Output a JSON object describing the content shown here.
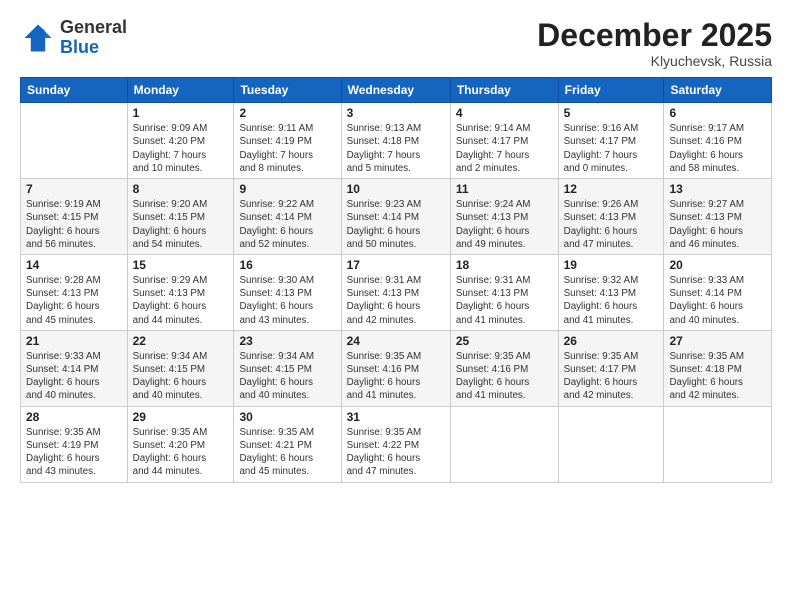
{
  "header": {
    "logo_general": "General",
    "logo_blue": "Blue",
    "month_title": "December 2025",
    "subtitle": "Klyuchevsk, Russia"
  },
  "weekdays": [
    "Sunday",
    "Monday",
    "Tuesday",
    "Wednesday",
    "Thursday",
    "Friday",
    "Saturday"
  ],
  "weeks": [
    [
      {
        "day": "",
        "info": ""
      },
      {
        "day": "1",
        "info": "Sunrise: 9:09 AM\nSunset: 4:20 PM\nDaylight: 7 hours\nand 10 minutes."
      },
      {
        "day": "2",
        "info": "Sunrise: 9:11 AM\nSunset: 4:19 PM\nDaylight: 7 hours\nand 8 minutes."
      },
      {
        "day": "3",
        "info": "Sunrise: 9:13 AM\nSunset: 4:18 PM\nDaylight: 7 hours\nand 5 minutes."
      },
      {
        "day": "4",
        "info": "Sunrise: 9:14 AM\nSunset: 4:17 PM\nDaylight: 7 hours\nand 2 minutes."
      },
      {
        "day": "5",
        "info": "Sunrise: 9:16 AM\nSunset: 4:17 PM\nDaylight: 7 hours\nand 0 minutes."
      },
      {
        "day": "6",
        "info": "Sunrise: 9:17 AM\nSunset: 4:16 PM\nDaylight: 6 hours\nand 58 minutes."
      }
    ],
    [
      {
        "day": "7",
        "info": "Sunrise: 9:19 AM\nSunset: 4:15 PM\nDaylight: 6 hours\nand 56 minutes."
      },
      {
        "day": "8",
        "info": "Sunrise: 9:20 AM\nSunset: 4:15 PM\nDaylight: 6 hours\nand 54 minutes."
      },
      {
        "day": "9",
        "info": "Sunrise: 9:22 AM\nSunset: 4:14 PM\nDaylight: 6 hours\nand 52 minutes."
      },
      {
        "day": "10",
        "info": "Sunrise: 9:23 AM\nSunset: 4:14 PM\nDaylight: 6 hours\nand 50 minutes."
      },
      {
        "day": "11",
        "info": "Sunrise: 9:24 AM\nSunset: 4:13 PM\nDaylight: 6 hours\nand 49 minutes."
      },
      {
        "day": "12",
        "info": "Sunrise: 9:26 AM\nSunset: 4:13 PM\nDaylight: 6 hours\nand 47 minutes."
      },
      {
        "day": "13",
        "info": "Sunrise: 9:27 AM\nSunset: 4:13 PM\nDaylight: 6 hours\nand 46 minutes."
      }
    ],
    [
      {
        "day": "14",
        "info": "Sunrise: 9:28 AM\nSunset: 4:13 PM\nDaylight: 6 hours\nand 45 minutes."
      },
      {
        "day": "15",
        "info": "Sunrise: 9:29 AM\nSunset: 4:13 PM\nDaylight: 6 hours\nand 44 minutes."
      },
      {
        "day": "16",
        "info": "Sunrise: 9:30 AM\nSunset: 4:13 PM\nDaylight: 6 hours\nand 43 minutes."
      },
      {
        "day": "17",
        "info": "Sunrise: 9:31 AM\nSunset: 4:13 PM\nDaylight: 6 hours\nand 42 minutes."
      },
      {
        "day": "18",
        "info": "Sunrise: 9:31 AM\nSunset: 4:13 PM\nDaylight: 6 hours\nand 41 minutes."
      },
      {
        "day": "19",
        "info": "Sunrise: 9:32 AM\nSunset: 4:13 PM\nDaylight: 6 hours\nand 41 minutes."
      },
      {
        "day": "20",
        "info": "Sunrise: 9:33 AM\nSunset: 4:14 PM\nDaylight: 6 hours\nand 40 minutes."
      }
    ],
    [
      {
        "day": "21",
        "info": "Sunrise: 9:33 AM\nSunset: 4:14 PM\nDaylight: 6 hours\nand 40 minutes."
      },
      {
        "day": "22",
        "info": "Sunrise: 9:34 AM\nSunset: 4:15 PM\nDaylight: 6 hours\nand 40 minutes."
      },
      {
        "day": "23",
        "info": "Sunrise: 9:34 AM\nSunset: 4:15 PM\nDaylight: 6 hours\nand 40 minutes."
      },
      {
        "day": "24",
        "info": "Sunrise: 9:35 AM\nSunset: 4:16 PM\nDaylight: 6 hours\nand 41 minutes."
      },
      {
        "day": "25",
        "info": "Sunrise: 9:35 AM\nSunset: 4:16 PM\nDaylight: 6 hours\nand 41 minutes."
      },
      {
        "day": "26",
        "info": "Sunrise: 9:35 AM\nSunset: 4:17 PM\nDaylight: 6 hours\nand 42 minutes."
      },
      {
        "day": "27",
        "info": "Sunrise: 9:35 AM\nSunset: 4:18 PM\nDaylight: 6 hours\nand 42 minutes."
      }
    ],
    [
      {
        "day": "28",
        "info": "Sunrise: 9:35 AM\nSunset: 4:19 PM\nDaylight: 6 hours\nand 43 minutes."
      },
      {
        "day": "29",
        "info": "Sunrise: 9:35 AM\nSunset: 4:20 PM\nDaylight: 6 hours\nand 44 minutes."
      },
      {
        "day": "30",
        "info": "Sunrise: 9:35 AM\nSunset: 4:21 PM\nDaylight: 6 hours\nand 45 minutes."
      },
      {
        "day": "31",
        "info": "Sunrise: 9:35 AM\nSunset: 4:22 PM\nDaylight: 6 hours\nand 47 minutes."
      },
      {
        "day": "",
        "info": ""
      },
      {
        "day": "",
        "info": ""
      },
      {
        "day": "",
        "info": ""
      }
    ]
  ]
}
